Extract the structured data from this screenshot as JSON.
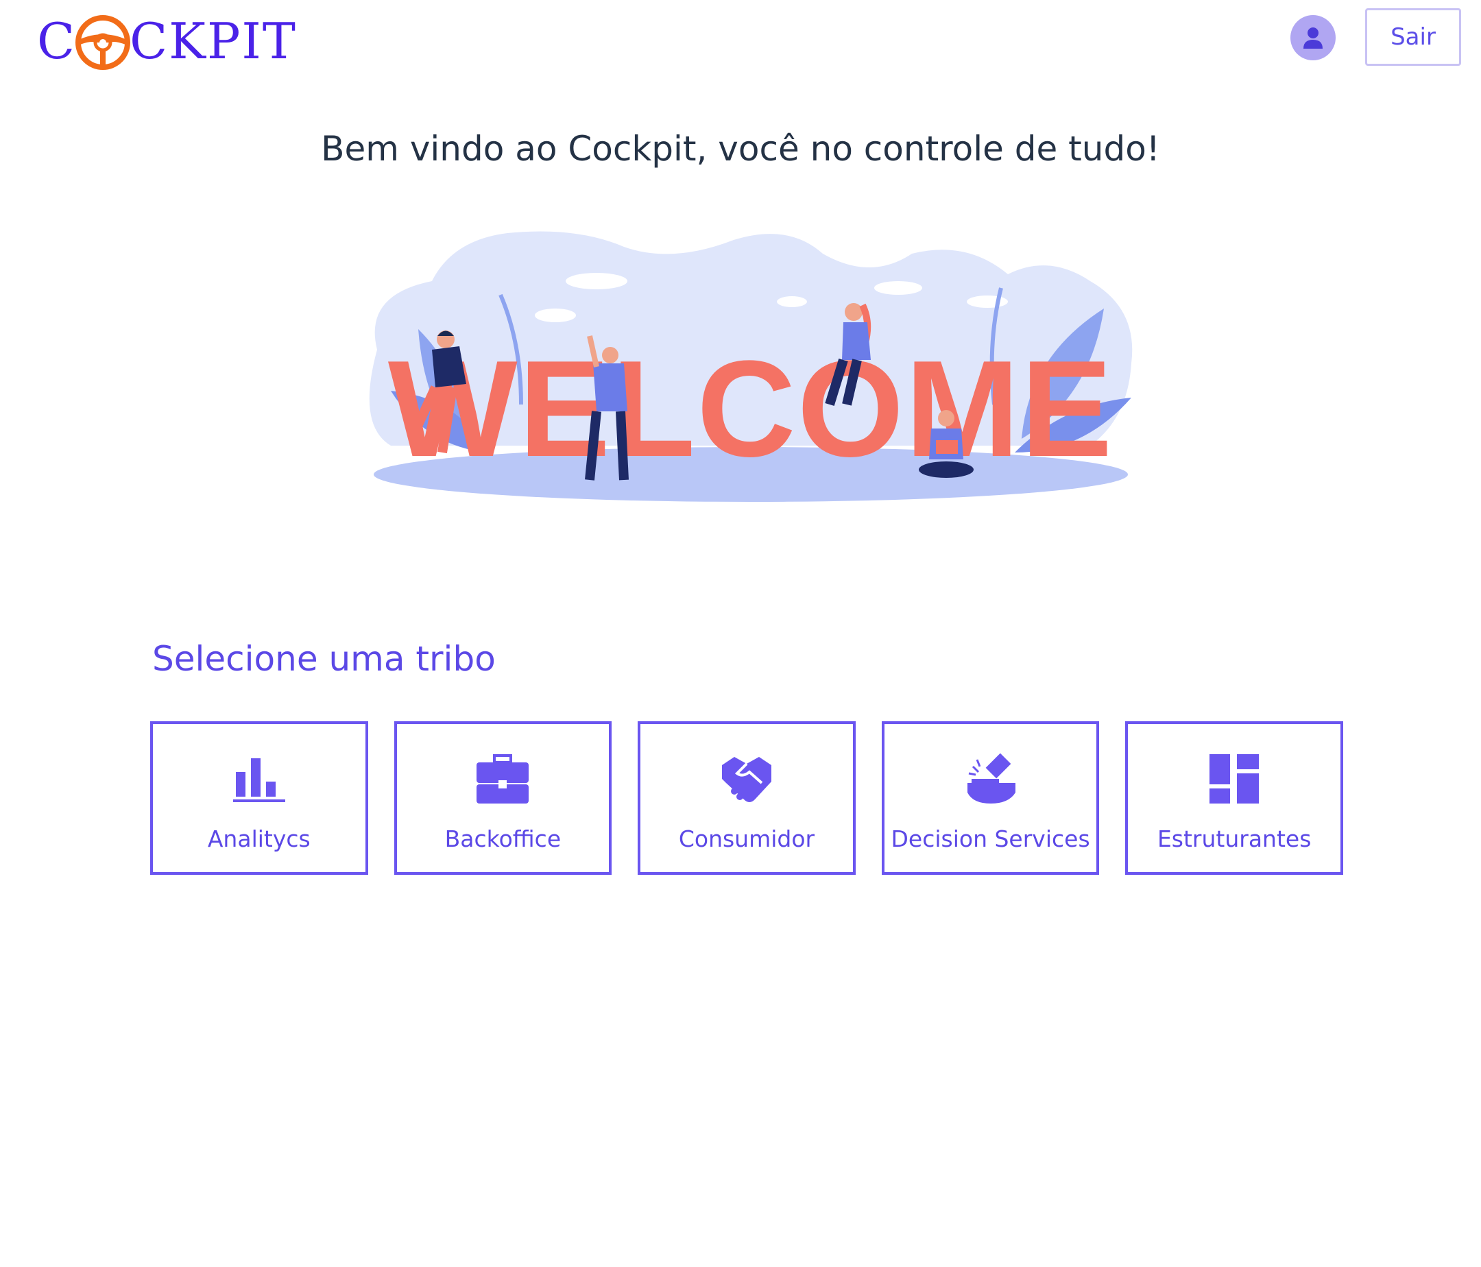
{
  "header": {
    "logo": {
      "first": "C",
      "rest": "CKPIT",
      "brand_color": "#4a22e8",
      "wheel_color": "#f26c18"
    },
    "avatar_icon": "user-icon",
    "logout_label": "Sair"
  },
  "main": {
    "welcome_message": "Bem vindo ao Cockpit, você no controle de tudo!",
    "illustration_word": "WELCOME",
    "section_title": "Selecione uma tribo",
    "tribes": [
      {
        "label": "Analitycs",
        "icon": "bar-chart-icon"
      },
      {
        "label": "Backoffice",
        "icon": "briefcase-icon"
      },
      {
        "label": "Consumidor",
        "icon": "handshake-icon"
      },
      {
        "label": "Decision Services",
        "icon": "gavel-icon"
      },
      {
        "label": "Estruturantes",
        "icon": "dashboard-icon"
      }
    ]
  },
  "colors": {
    "accent": "#6a55f0",
    "heading": "#243245",
    "illustration_letters": "#f47264",
    "illustration_bg": "#dde4fb"
  }
}
